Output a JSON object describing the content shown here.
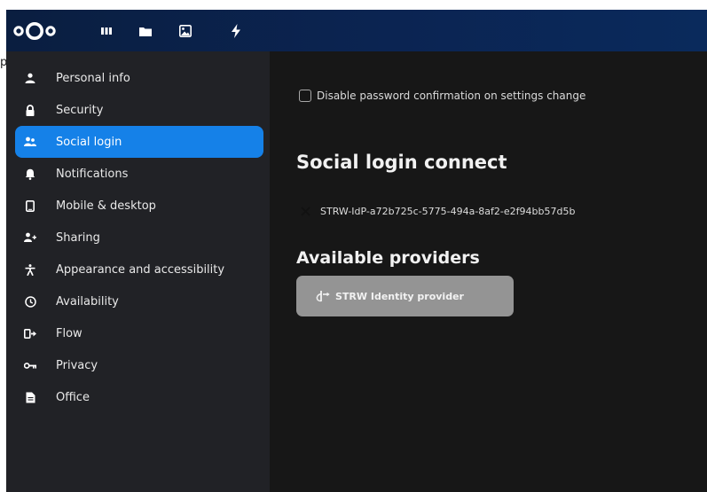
{
  "header": {
    "logo_icon": "nextcloud-logo-icon",
    "apps": [
      {
        "name": "dashboard-icon"
      },
      {
        "name": "files-icon"
      },
      {
        "name": "photos-icon"
      },
      {
        "name": "activity-icon"
      }
    ],
    "colors": {
      "start": "#0a1e40",
      "end": "#0a2a5c"
    }
  },
  "sidebar": {
    "items": [
      {
        "label": "Personal info",
        "icon": "user-icon"
      },
      {
        "label": "Security",
        "icon": "lock-icon"
      },
      {
        "label": "Social login",
        "icon": "group-icon",
        "active": true
      },
      {
        "label": "Notifications",
        "icon": "bell-icon"
      },
      {
        "label": "Mobile & desktop",
        "icon": "phone-icon"
      },
      {
        "label": "Sharing",
        "icon": "share-user-icon"
      },
      {
        "label": "Appearance and accessibility",
        "icon": "accessibility-icon"
      },
      {
        "label": "Availability",
        "icon": "clock-icon"
      },
      {
        "label": "Flow",
        "icon": "flow-icon"
      },
      {
        "label": "Privacy",
        "icon": "key-icon"
      },
      {
        "label": "Office",
        "icon": "document-icon"
      }
    ],
    "active_color": "#1581e8"
  },
  "main": {
    "checkbox_label": "Disable password confirmation on settings change",
    "checkbox_checked": false,
    "heading": "Social login connect",
    "connection": "STRW-IdP-a72b725c-5775-494a-8af2-e2f94bb57d5b",
    "providers_heading": "Available providers",
    "provider_button": "STRW Identity provider",
    "provider_icon": "openid-icon"
  }
}
